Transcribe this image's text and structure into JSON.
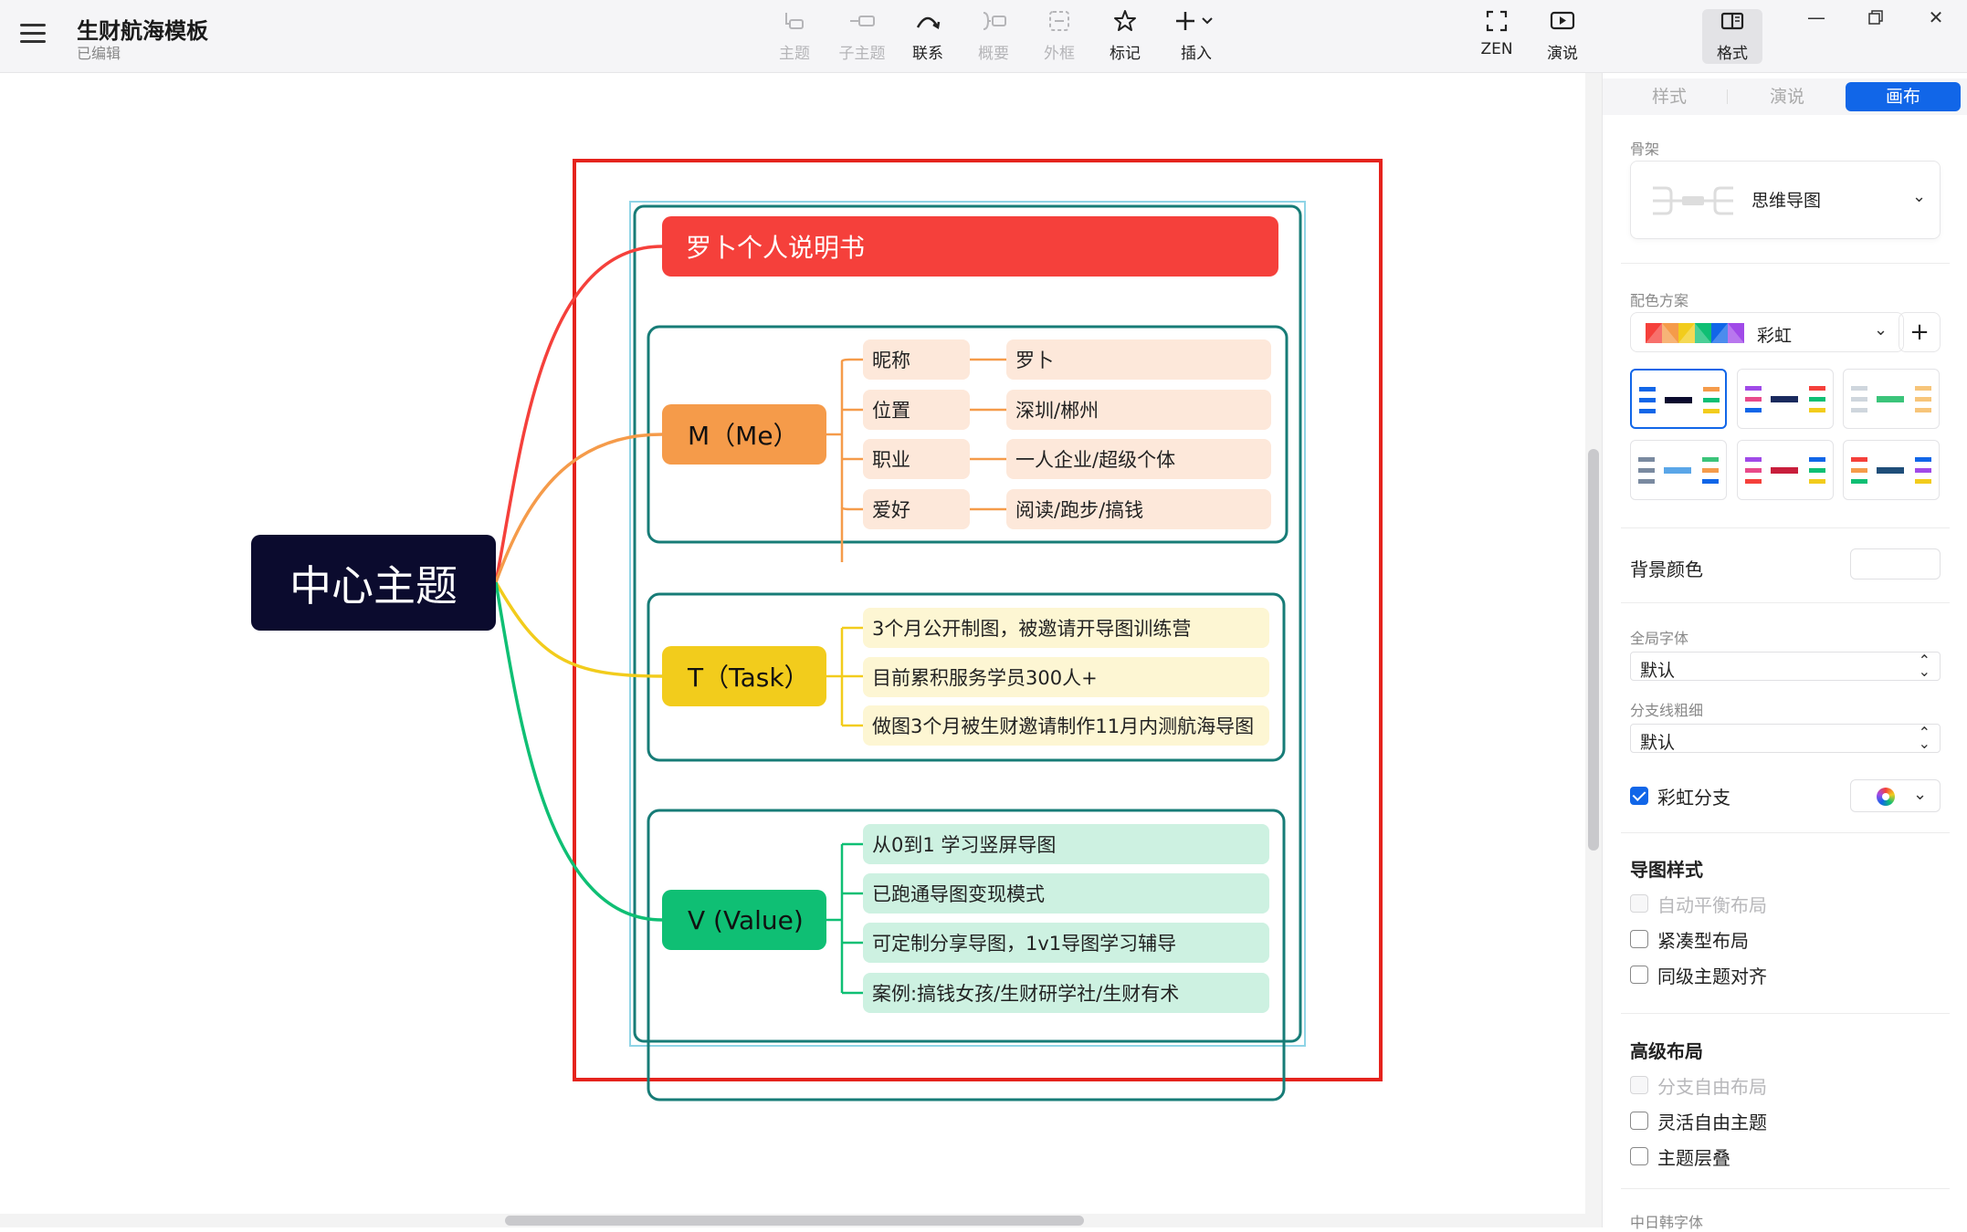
{
  "app": {
    "title": "生财航海模板",
    "subtitle": "已编辑"
  },
  "toolbar": {
    "topic": "主题",
    "subtopic": "子主题",
    "relation": "联系",
    "summary": "概要",
    "boundary": "外框",
    "marker": "标记",
    "insert": "插入",
    "zen": "ZEN",
    "present": "演说",
    "format": "格式"
  },
  "mindmap": {
    "central": "中心主题",
    "title": "罗卜个人说明书",
    "m": {
      "label": "M（Me）",
      "items": [
        {
          "key": "昵称",
          "value": "罗卜"
        },
        {
          "key": "位置",
          "value": "深圳/郴州"
        },
        {
          "key": "职业",
          "value": "一人企业/超级个体"
        },
        {
          "key": "爱好",
          "value": "阅读/跑步/搞钱"
        }
      ]
    },
    "t": {
      "label": "T（Task）",
      "items": [
        "3个月公开制图，被邀请开导图训练营",
        "目前累积服务学员300人+",
        "做图3个月被生财邀请制作11月内测航海导图"
      ]
    },
    "v": {
      "label": "V (Value)",
      "items": [
        "从0到1 学习竖屏导图",
        "已跑通导图变现模式",
        "可定制分享导图，1v1导图学习辅导",
        "案例:搞钱女孩/生财研学社/生财有术"
      ]
    }
  },
  "panel": {
    "tabs": [
      "样式",
      "演说",
      "画布"
    ],
    "skeleton_label": "骨架",
    "skeleton_value": "思维导图",
    "scheme_label": "配色方案",
    "scheme_value": "彩虹",
    "bg_color_label": "背景颜色",
    "global_font_label": "全局字体",
    "global_font_value": "默认",
    "branch_width_label": "分支线粗细",
    "branch_width_value": "默认",
    "rainbow_branch": "彩虹分支",
    "map_style_title": "导图样式",
    "auto_balance": "自动平衡布局",
    "compact": "紧凑型布局",
    "align_same_level": "同级主题对齐",
    "advanced_title": "高级布局",
    "branch_free": "分支自由布局",
    "flexible_free": "灵活自由主题",
    "overlap": "主题层叠",
    "cjk_font": "中日韩字体"
  }
}
